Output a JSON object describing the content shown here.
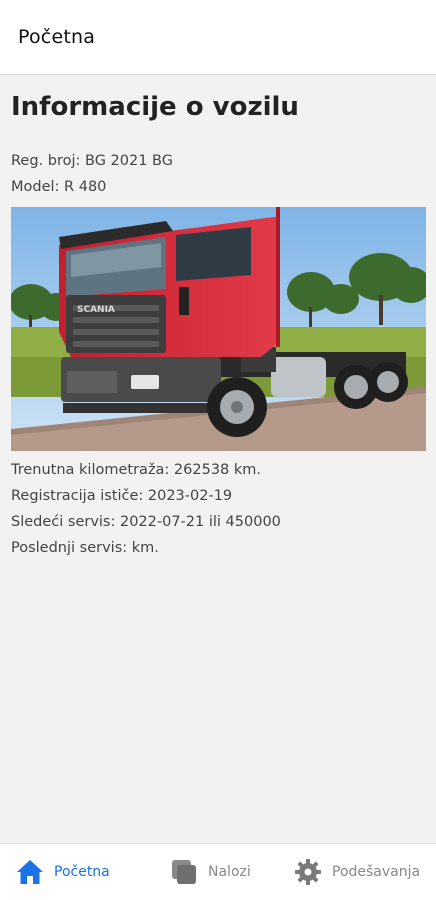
{
  "header": {
    "title": "Početna"
  },
  "main": {
    "title": "Informacije o vozilu",
    "reg_number": "Reg. broj: BG 2021 BG",
    "model": "Model: R 480",
    "current_mileage": "Trenutna kilometraža: 262538 km.",
    "registration_expires": "Registracija ističe: 2023-02-19",
    "next_service": "Sledeći servis: 2022-07-21 ili 450000",
    "last_service": "Poslednji servis:  km.",
    "truck_grille_badge": "SCANIA"
  },
  "tabbar": {
    "tabs": [
      {
        "label": "Početna",
        "icon": "home-icon",
        "active": true
      },
      {
        "label": "Nalozi",
        "icon": "orders-icon",
        "active": false
      },
      {
        "label": "Podešavanja",
        "icon": "gear-icon",
        "active": false
      }
    ]
  },
  "colors": {
    "accent": "#1a73e8",
    "background": "#f2f2f2",
    "inactive_tab": "#888888",
    "truck_cab": "#d42b3a"
  }
}
